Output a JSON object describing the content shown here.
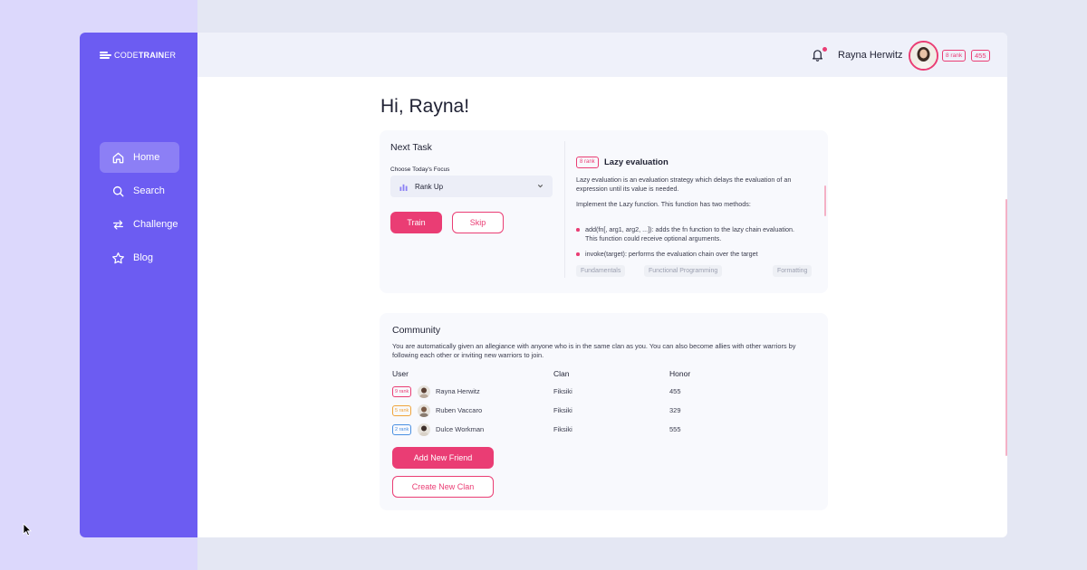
{
  "app": {
    "brand_prefix": "CODE",
    "brand_bold": "TRAIN",
    "brand_suffix": "ER"
  },
  "sidebar": {
    "items": [
      {
        "label": "Home",
        "icon": "home-icon",
        "active": true
      },
      {
        "label": "Search",
        "icon": "search-icon",
        "active": false
      },
      {
        "label": "Challenge",
        "icon": "swap-arrows-icon",
        "active": false
      },
      {
        "label": "Blog",
        "icon": "star-icon",
        "active": false
      }
    ]
  },
  "header": {
    "notifications_count": "1",
    "user_name": "Rayna Herwitz",
    "rank": "8 rank",
    "honor": "455"
  },
  "greeting": "Hi, Rayna!",
  "next_task": {
    "title": "Next Task",
    "focus_label": "Choose Today's Focus",
    "focus_value": "Rank Up",
    "train_label": "Train",
    "skip_label": "Skip",
    "kata": {
      "rank": "8 rank",
      "title": "Lazy evaluation",
      "description": "Lazy evaluation is an evaluation strategy which delays the evaluation of an expression until its value is needed.",
      "instruction": "Implement the Lazy function. This function has two methods:",
      "methods": [
        "add(fn[, arg1, arg2, ...]): adds the fn function to the lazy chain evaluation. This function could receive optional arguments.",
        "invoke(target): performs the evaluation chain over the target"
      ],
      "tags": [
        "Fundamentals",
        "Functional Programming",
        "Formatting"
      ]
    }
  },
  "community": {
    "title": "Community",
    "description": "You are automatically given an allegiance with anyone who is in the same clan as you. You can also become allies with other warriors by following each other or inviting new warriors to join.",
    "columns": [
      "User",
      "Clan",
      "Honor"
    ],
    "rows": [
      {
        "rank": "9 rank",
        "rank_color": "#ea3d74",
        "user": "Rayna Herwitz",
        "clan": "Fiksiki",
        "honor": "455"
      },
      {
        "rank": "5 rank",
        "rank_color": "#f0a43a",
        "user": "Ruben Vaccaro",
        "clan": "Fiksiki",
        "honor": "329"
      },
      {
        "rank": "2 rank",
        "rank_color": "#4a90e2",
        "user": "Dulce Workman",
        "clan": "Fiksiki",
        "honor": "555"
      }
    ],
    "add_friend_label": "Add New Friend",
    "create_clan_label": "Create New Clan"
  },
  "colors": {
    "sidebar": "#6c5cf2",
    "accent": "#ea3d74",
    "background": "#e4e7f3"
  }
}
